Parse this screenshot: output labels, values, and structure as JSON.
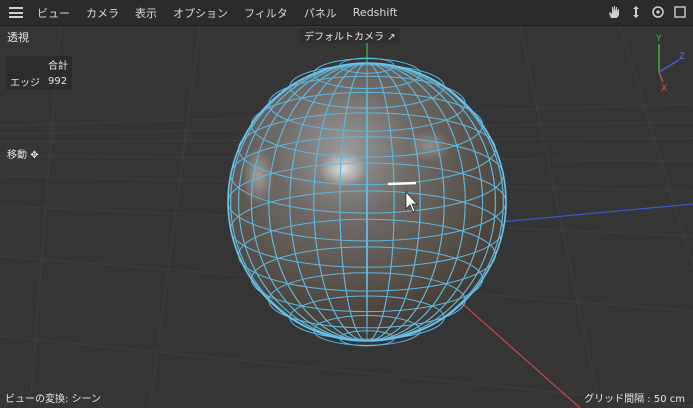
{
  "menu": {
    "items": [
      "ビュー",
      "カメラ",
      "表示",
      "オプション",
      "フィルタ",
      "パネル",
      "Redshift"
    ],
    "right_icons": [
      "pan-hand-icon",
      "move-view-icon",
      "rotate-view-icon",
      "maximize-view-icon"
    ]
  },
  "viewport": {
    "view_name": "透視",
    "camera": "デフォルトカメラ",
    "camera_icon": "camera-link-icon",
    "stats": {
      "header": "合計",
      "edge_label": "エッジ",
      "edge_value": "992"
    },
    "tool_label": "移動",
    "tool_icon": "move-crosshair-icon",
    "footer_left": "ビューの変換: シーン",
    "footer_right": "グリッド間隔 : 50 cm",
    "axes": {
      "y": "Y",
      "z": "Z",
      "x": "X"
    }
  },
  "colors": {
    "background": "#353535",
    "sphere_wire": "#5fb8e0",
    "axis_x": "#d05050",
    "axis_y": "#40c040",
    "axis_z": "#4060d0"
  }
}
